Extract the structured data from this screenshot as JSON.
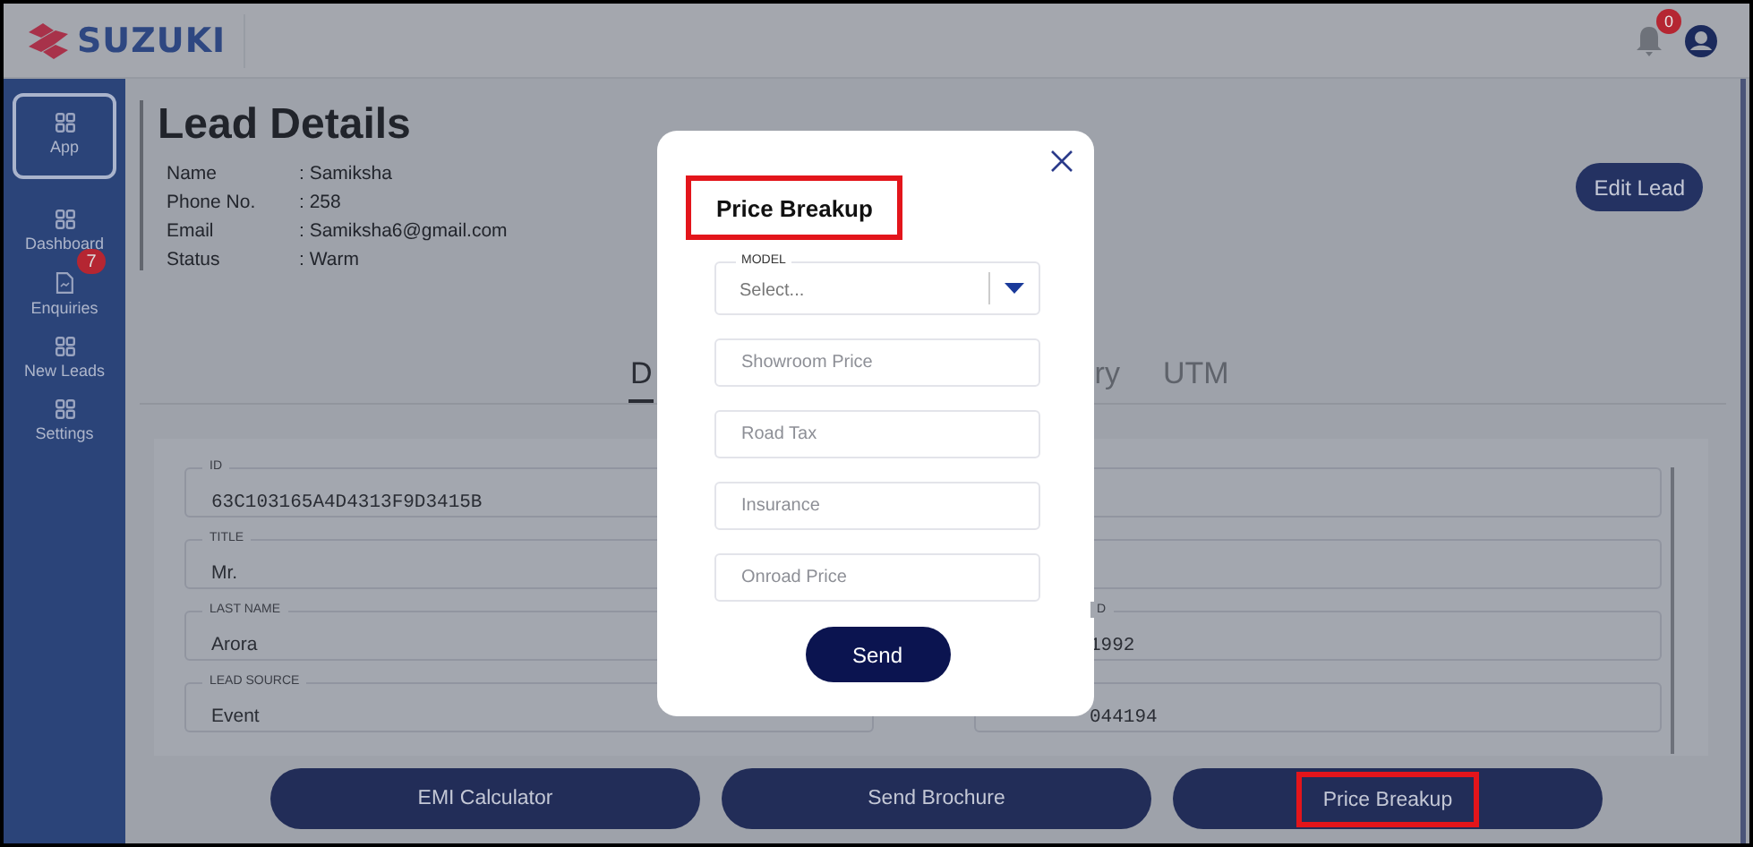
{
  "header": {
    "logo": "SUZUKI",
    "notification_count": "0"
  },
  "sidebar": {
    "items": [
      {
        "label": "App",
        "selected": true,
        "kind": "grid"
      },
      {
        "label": "Dashboard",
        "selected": false,
        "kind": "grid"
      },
      {
        "label": "Enquiries",
        "selected": false,
        "kind": "doc",
        "badge": "7"
      },
      {
        "label": "New Leads",
        "selected": false,
        "kind": "grid"
      },
      {
        "label": "Settings",
        "selected": false,
        "kind": "grid"
      }
    ]
  },
  "page": {
    "title": "Lead Details",
    "edit_button": "Edit Lead",
    "info": [
      {
        "label": "Name",
        "value": ": Samiksha"
      },
      {
        "label": "Phone No.",
        "value": ": 258"
      },
      {
        "label": "Email",
        "value": ": Samiksha6@gmail.com"
      },
      {
        "label": "Status",
        "value": ": Warm"
      }
    ]
  },
  "tabs": [
    {
      "label": "D",
      "selected": true
    },
    {
      "label": "ry",
      "selected": false
    },
    {
      "label": "UTM",
      "selected": false
    }
  ],
  "fields_left": [
    {
      "kind": "code",
      "label": "ID",
      "value": "63C103165A4D4313F9D3415B"
    },
    {
      "kind": "text",
      "label": "TITLE",
      "value": "Mr."
    },
    {
      "kind": "text",
      "label": "LAST NAME",
      "value": "Arora"
    },
    {
      "kind": "text",
      "label": "LEAD SOURCE",
      "value": "Event"
    }
  ],
  "fields_right": [
    {
      "kind": "blank"
    },
    {
      "kind": "blank"
    },
    {
      "kind": "code",
      "label": "D",
      "value": "1992"
    },
    {
      "kind": "code",
      "value": "044194"
    }
  ],
  "actions": [
    {
      "label": "EMI Calculator",
      "highlighted": false
    },
    {
      "label": "Send Brochure",
      "highlighted": false
    },
    {
      "label": "Price Breakup",
      "highlighted": true
    }
  ],
  "modal": {
    "title": "Price Breakup",
    "title_highlighted": true,
    "model": {
      "label": "MODEL",
      "placeholder": "Select..."
    },
    "fields": [
      {
        "placeholder": "Showroom Price"
      },
      {
        "placeholder": "Road Tax"
      },
      {
        "placeholder": "Insurance"
      },
      {
        "placeholder": "Onroad Price"
      }
    ],
    "submit": "Send"
  }
}
